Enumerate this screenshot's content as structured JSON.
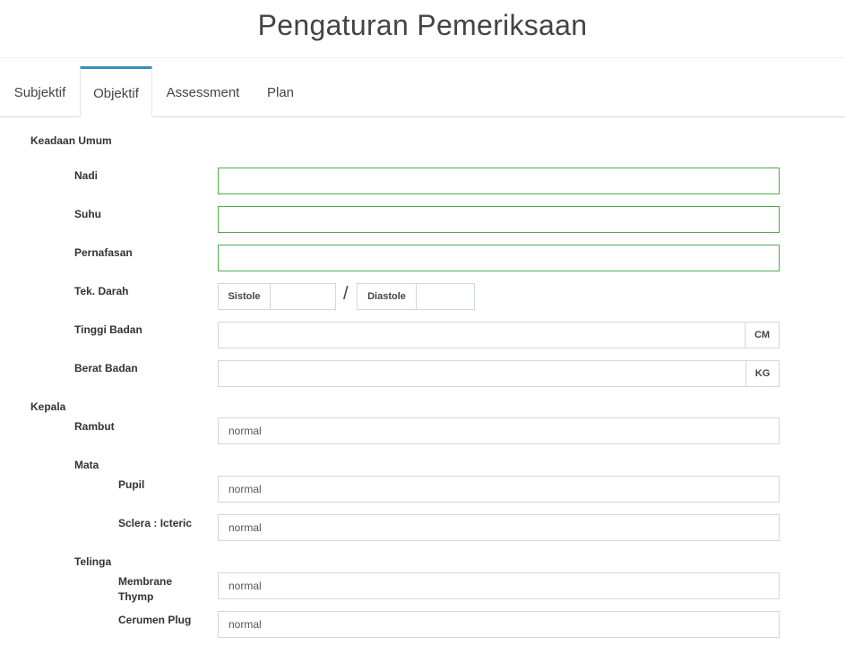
{
  "page": {
    "title": "Pengaturan Pemeriksaan"
  },
  "tabs": [
    {
      "label": "Subjektif"
    },
    {
      "label": "Objektif"
    },
    {
      "label": "Assessment"
    },
    {
      "label": "Plan"
    }
  ],
  "active_tab": "Objektif",
  "form": {
    "keadaan_umum": {
      "label": "Keadaan Umum",
      "nadi": {
        "label": "Nadi",
        "value": ""
      },
      "suhu": {
        "label": "Suhu",
        "value": ""
      },
      "pernafasan": {
        "label": "Pernafasan",
        "value": ""
      },
      "tek_darah": {
        "label": "Tek. Darah",
        "sistole_label": "Sistole",
        "sistole_value": "",
        "separator": "/",
        "diastole_label": "Diastole",
        "diastole_value": ""
      },
      "tinggi_badan": {
        "label": "Tinggi Badan",
        "value": "",
        "unit": "CM"
      },
      "berat_badan": {
        "label": "Berat Badan",
        "value": "",
        "unit": "KG"
      }
    },
    "kepala": {
      "label": "Kepala",
      "rambut": {
        "label": "Rambut",
        "value": "normal"
      },
      "mata": {
        "label": "Mata",
        "pupil": {
          "label": "Pupil",
          "value": "normal"
        },
        "sclera": {
          "label": "Sclera : Icteric",
          "value": "normal"
        }
      },
      "telinga": {
        "label": "Telinga",
        "membrane": {
          "label_line1": "Membrane",
          "label_line2": "Thymp",
          "value": "normal"
        },
        "cerumen": {
          "label": "Cerumen Plug",
          "value": "normal"
        }
      }
    }
  },
  "colors": {
    "accent": "#3c8dbc",
    "valid_border": "#4cae4c",
    "border": "#d2d6de"
  }
}
